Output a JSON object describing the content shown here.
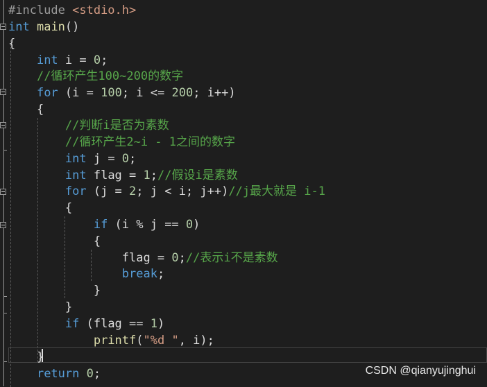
{
  "code": {
    "lines": [
      [
        {
          "t": "#include ",
          "c": "pp"
        },
        {
          "t": "<stdio.h>",
          "c": "inc"
        }
      ],
      [
        {
          "t": "int",
          "c": "kw"
        },
        {
          "t": " ",
          "c": "pl"
        },
        {
          "t": "main",
          "c": "fn"
        },
        {
          "t": "()",
          "c": "pl"
        }
      ],
      [
        {
          "t": "{",
          "c": "pl"
        }
      ],
      [
        {
          "t": "    ",
          "c": "pl"
        },
        {
          "t": "int",
          "c": "kw"
        },
        {
          "t": " i = ",
          "c": "pl"
        },
        {
          "t": "0",
          "c": "nm"
        },
        {
          "t": ";",
          "c": "pl"
        }
      ],
      [
        {
          "t": "    ",
          "c": "pl"
        },
        {
          "t": "//循环产生100~200的数字",
          "c": "cm"
        }
      ],
      [
        {
          "t": "    ",
          "c": "pl"
        },
        {
          "t": "for",
          "c": "kw"
        },
        {
          "t": " (i = ",
          "c": "pl"
        },
        {
          "t": "100",
          "c": "nm"
        },
        {
          "t": "; i <= ",
          "c": "pl"
        },
        {
          "t": "200",
          "c": "nm"
        },
        {
          "t": "; i++)",
          "c": "pl"
        }
      ],
      [
        {
          "t": "    {",
          "c": "pl"
        }
      ],
      [
        {
          "t": "        ",
          "c": "pl"
        },
        {
          "t": "//判断i是否为素数",
          "c": "cm"
        }
      ],
      [
        {
          "t": "        ",
          "c": "pl"
        },
        {
          "t": "//循环产生2~i - 1之间的数字",
          "c": "cm"
        }
      ],
      [
        {
          "t": "        ",
          "c": "pl"
        },
        {
          "t": "int",
          "c": "kw"
        },
        {
          "t": " j = ",
          "c": "pl"
        },
        {
          "t": "0",
          "c": "nm"
        },
        {
          "t": ";",
          "c": "pl"
        }
      ],
      [
        {
          "t": "        ",
          "c": "pl"
        },
        {
          "t": "int",
          "c": "kw"
        },
        {
          "t": " flag = ",
          "c": "pl"
        },
        {
          "t": "1",
          "c": "nm"
        },
        {
          "t": ";",
          "c": "pl"
        },
        {
          "t": "//假设i是素数",
          "c": "cm"
        }
      ],
      [
        {
          "t": "        ",
          "c": "pl"
        },
        {
          "t": "for",
          "c": "kw"
        },
        {
          "t": " (j = ",
          "c": "pl"
        },
        {
          "t": "2",
          "c": "nm"
        },
        {
          "t": "; j < i; j++)",
          "c": "pl"
        },
        {
          "t": "//j最大就是 i-1",
          "c": "cm"
        }
      ],
      [
        {
          "t": "        {",
          "c": "pl"
        }
      ],
      [
        {
          "t": "            ",
          "c": "pl"
        },
        {
          "t": "if",
          "c": "kw"
        },
        {
          "t": " (i % j == ",
          "c": "pl"
        },
        {
          "t": "0",
          "c": "nm"
        },
        {
          "t": ")",
          "c": "pl"
        }
      ],
      [
        {
          "t": "            {",
          "c": "pl"
        }
      ],
      [
        {
          "t": "                flag = ",
          "c": "pl"
        },
        {
          "t": "0",
          "c": "nm"
        },
        {
          "t": ";",
          "c": "pl"
        },
        {
          "t": "//表示i不是素数",
          "c": "cm"
        }
      ],
      [
        {
          "t": "                ",
          "c": "pl"
        },
        {
          "t": "break",
          "c": "kw"
        },
        {
          "t": ";",
          "c": "pl"
        }
      ],
      [
        {
          "t": "            }",
          "c": "pl"
        }
      ],
      [
        {
          "t": "        }",
          "c": "pl"
        }
      ],
      [
        {
          "t": "        ",
          "c": "pl"
        },
        {
          "t": "if",
          "c": "kw"
        },
        {
          "t": " (flag == ",
          "c": "pl"
        },
        {
          "t": "1",
          "c": "nm"
        },
        {
          "t": ")",
          "c": "pl"
        }
      ],
      [
        {
          "t": "            ",
          "c": "pl"
        },
        {
          "t": "printf",
          "c": "fn"
        },
        {
          "t": "(",
          "c": "pl"
        },
        {
          "t": "\"%d \"",
          "c": "str"
        },
        {
          "t": ", i);",
          "c": "pl"
        }
      ],
      [
        {
          "t": "    }",
          "c": "pl"
        }
      ],
      [
        {
          "t": "    ",
          "c": "pl"
        },
        {
          "t": "return",
          "c": "kw"
        },
        {
          "t": " ",
          "c": "pl"
        },
        {
          "t": "0",
          "c": "nm"
        },
        {
          "t": ";",
          "c": "pl"
        }
      ]
    ]
  },
  "watermark": "CSDN @qianyujinghui",
  "colors": {
    "background": "#1e1e1e",
    "keyword": "#569cd6",
    "comment": "#57a64a",
    "number": "#b5cea8",
    "string": "#d69d85",
    "function": "#dcdcaa",
    "plain": "#dcdcdc"
  }
}
